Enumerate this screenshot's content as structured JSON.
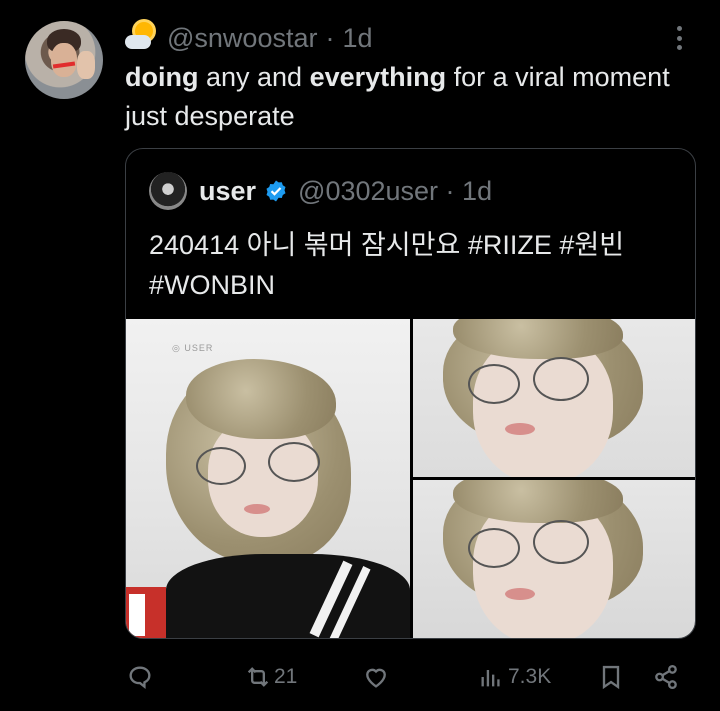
{
  "tweet": {
    "handle": "@snwoostar",
    "time": "1d",
    "text_parts": {
      "p1_bold": "doing",
      "p2": " any and ",
      "p3_bold": "everything",
      "p4": " for a viral moment just desperate"
    }
  },
  "quote": {
    "name": "user",
    "handle": "@0302user",
    "time": "1d",
    "text": "240414 아니 볶머 잠시만요 #RIIZE #원빈 #WONBIN",
    "watermark": "◎ USER"
  },
  "actions": {
    "retweets": "21",
    "views": "7.3K"
  },
  "icons": {
    "header_emoji": "sun-behind-cloud-icon",
    "more": "more-vertical-icon",
    "verified": "verified-badge-icon",
    "reply": "reply-icon",
    "retweet": "retweet-icon",
    "like": "heart-icon",
    "views": "views-icon",
    "bookmark": "bookmark-icon",
    "share": "share-icon"
  },
  "colors": {
    "background": "#000000",
    "text_primary": "#e7e9ea",
    "text_secondary": "#71767b",
    "verified": "#1d9bf0"
  }
}
